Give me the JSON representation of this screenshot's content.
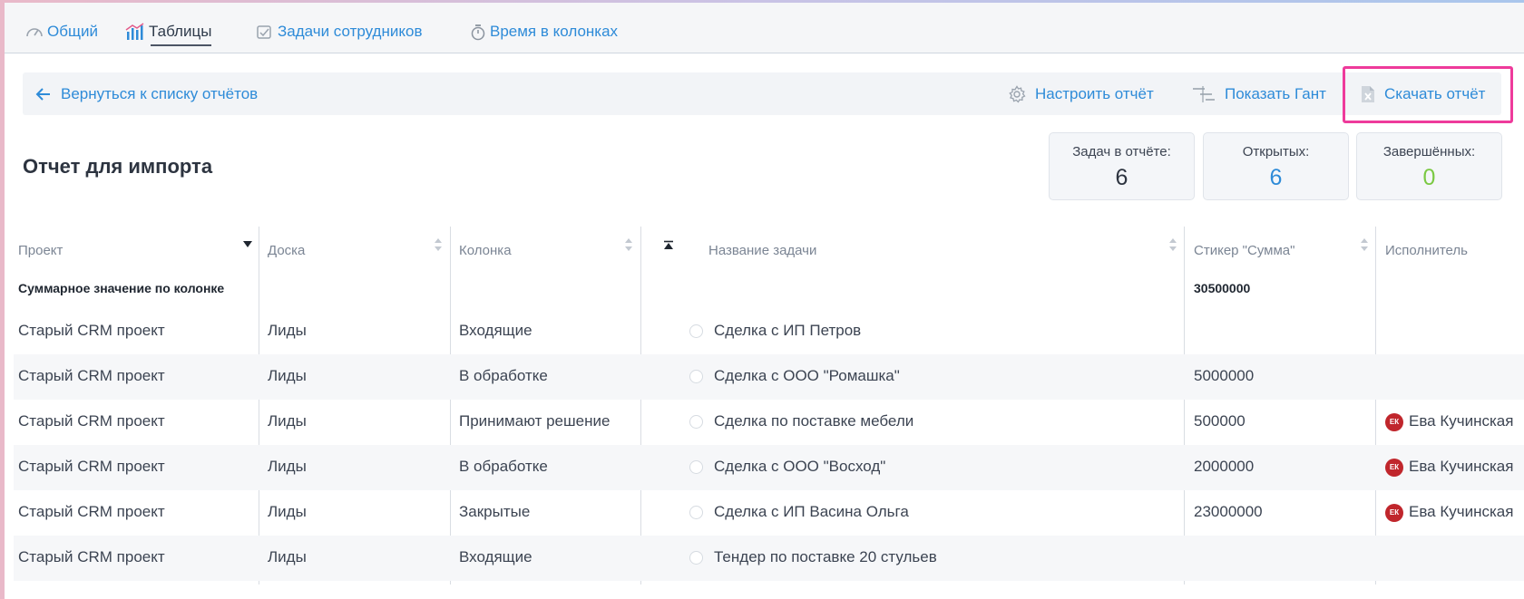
{
  "tabs": [
    {
      "label": "Общий",
      "icon": "gauge-icon"
    },
    {
      "label": "Таблицы",
      "icon": "bar-chart-icon",
      "active": true
    },
    {
      "label": "Задачи сотрудников",
      "icon": "checklist-icon"
    },
    {
      "label": "Время в колонках",
      "icon": "stopwatch-icon"
    }
  ],
  "actions": {
    "back_label": "Вернуться к списку отчётов",
    "configure_label": "Настроить отчёт",
    "gantt_label": "Показать Гант",
    "download_label": "Скачать отчёт"
  },
  "report": {
    "title": "Отчет для импорта",
    "stats": [
      {
        "label": "Задач в отчёте:",
        "value": "6",
        "color": "#2d3440"
      },
      {
        "label": "Открытых:",
        "value": "6",
        "color": "#2e8bd8"
      },
      {
        "label": "Завершённых:",
        "value": "0",
        "color": "#7ac943"
      }
    ]
  },
  "table": {
    "columns": [
      "Проект",
      "Доска",
      "Колонка",
      "Название задачи",
      "Стикер \"Сумма\"",
      "Исполнитель"
    ],
    "summary": {
      "label": "Суммарное значение по колонке",
      "sum": "30500000"
    },
    "rows": [
      {
        "project": "Старый CRM проект",
        "board": "Лиды",
        "column": "Входящие",
        "task": "Сделка с ИП Петров",
        "sum": "",
        "assignee": "",
        "initials": ""
      },
      {
        "project": "Старый CRM проект",
        "board": "Лиды",
        "column": "В обработке",
        "task": "Сделка с ООО \"Ромашка\"",
        "sum": "5000000",
        "assignee": "",
        "initials": ""
      },
      {
        "project": "Старый CRM проект",
        "board": "Лиды",
        "column": "Принимают решение",
        "task": "Сделка по поставке мебели",
        "sum": "500000",
        "assignee": "Ева Кучинская",
        "initials": "ЕК"
      },
      {
        "project": "Старый CRM проект",
        "board": "Лиды",
        "column": "В обработке",
        "task": "Сделка с ООО \"Восход\"",
        "sum": "2000000",
        "assignee": "Ева Кучинская",
        "initials": "ЕК"
      },
      {
        "project": "Старый CRM проект",
        "board": "Лиды",
        "column": "Закрытые",
        "task": "Сделка с ИП Васина Ольга",
        "sum": "23000000",
        "assignee": "Ева Кучинская",
        "initials": "ЕК"
      },
      {
        "project": "Старый CRM проект",
        "board": "Лиды",
        "column": "Входящие",
        "task": "Тендер по поставке 20 стульев",
        "sum": "",
        "assignee": "",
        "initials": ""
      }
    ]
  },
  "colors": {
    "accent": "#2e8bd8",
    "highlight": "#ee3a9b",
    "avatar": "#c0262c",
    "completed": "#7ac943"
  }
}
